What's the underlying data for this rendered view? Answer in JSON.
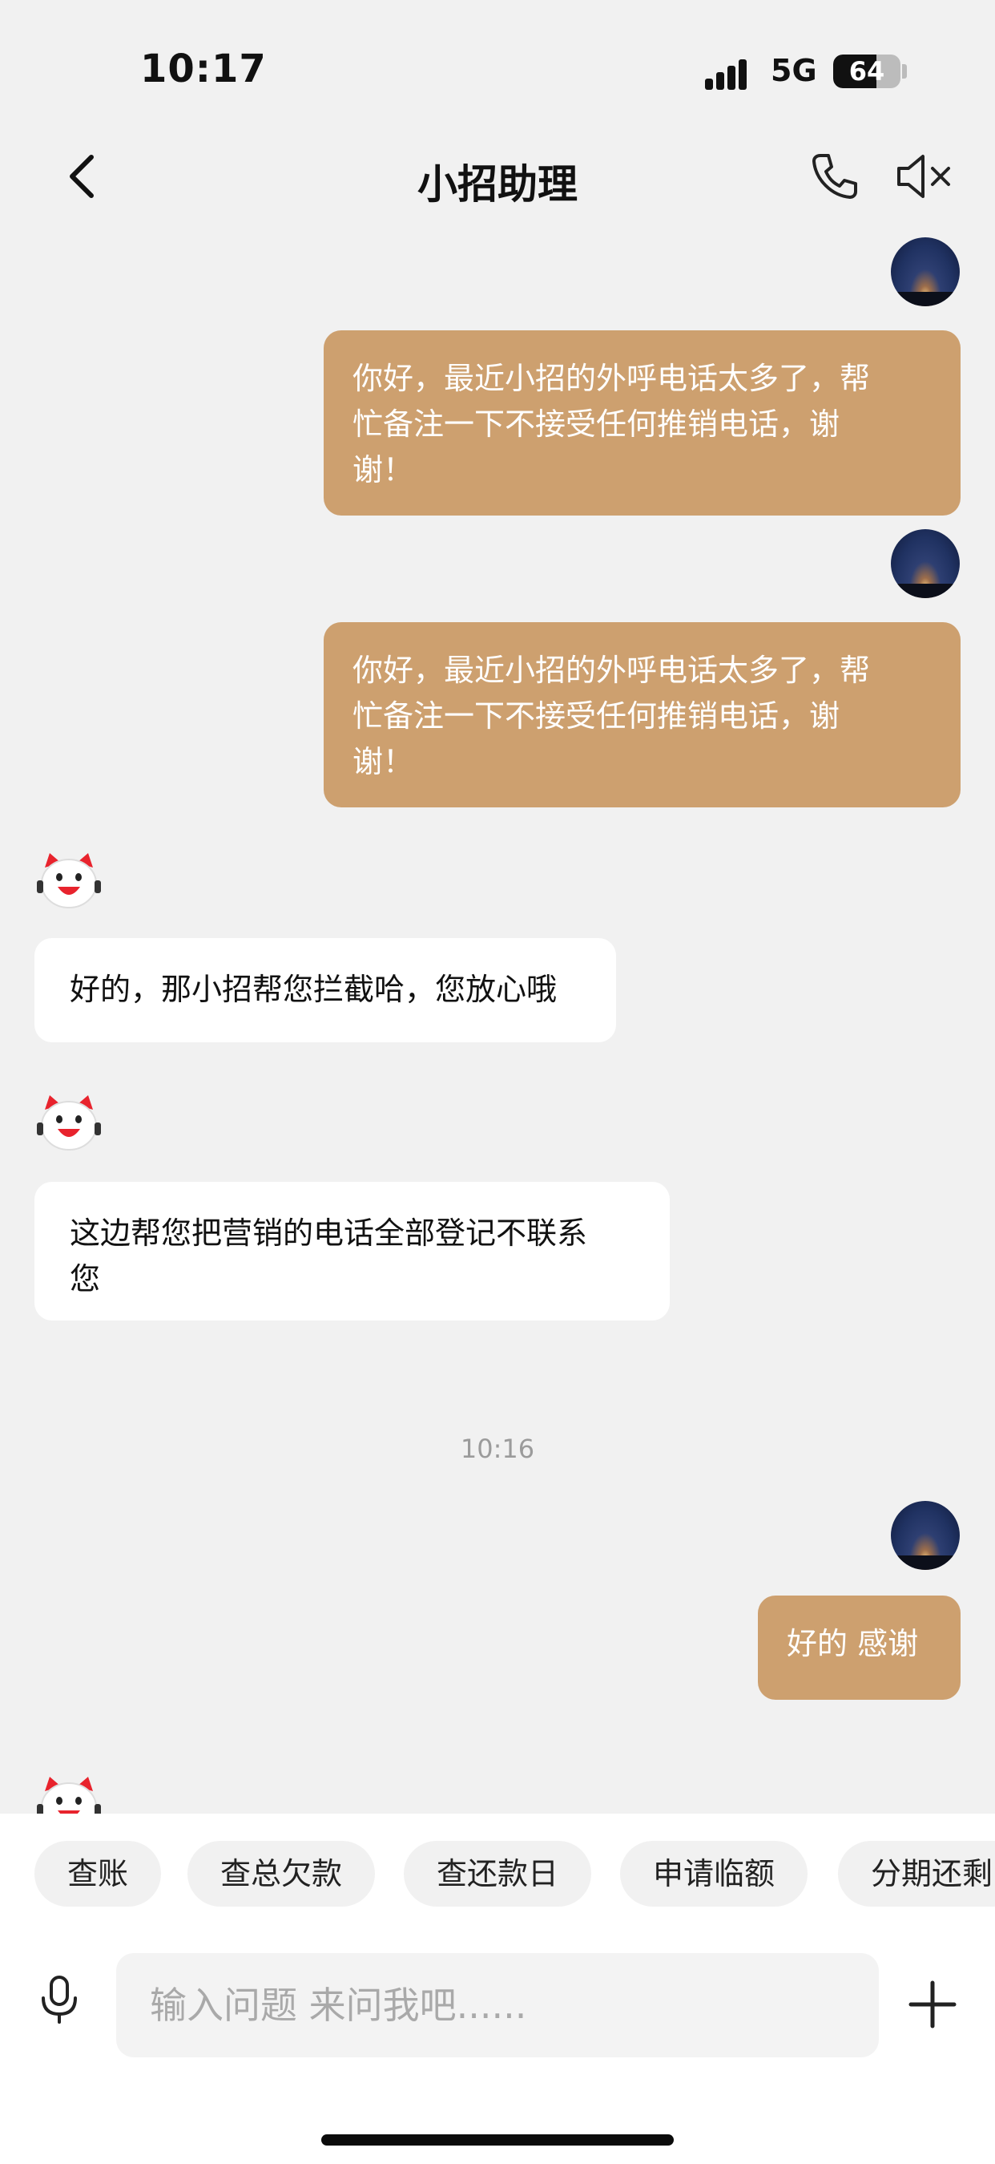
{
  "status_bar": {
    "time": "10:17",
    "network": "5G",
    "battery": "64"
  },
  "nav": {
    "title": "小招助理"
  },
  "messages": {
    "user_1_line1": "你好，最近小招的外呼电话太多了，帮",
    "user_1_line2": "忙备注一下不接受任何推销电话，谢",
    "user_1_line3": "谢！",
    "user_2_line1": "你好，最近小招的外呼电话太多了，帮",
    "user_2_line2": "忙备注一下不接受任何推销电话，谢",
    "user_2_line3": "谢！",
    "bot_1": "好的，那小招帮您拦截哈，您放心哦",
    "bot_2_line1": "这边帮您把营销的电话全部登记不联系",
    "bot_2_line2": "您",
    "timestamp": "10:16",
    "user_3": "好的 感谢"
  },
  "quick_replies": [
    "查账",
    "查总欠款",
    "查还款日",
    "申请临额",
    "分期还剩"
  ],
  "input": {
    "placeholder": "输入问题 来问我吧......"
  },
  "colors": {
    "user_bubble": "#cda06f",
    "bot_bubble": "#ffffff",
    "background": "#f1f1f1"
  }
}
